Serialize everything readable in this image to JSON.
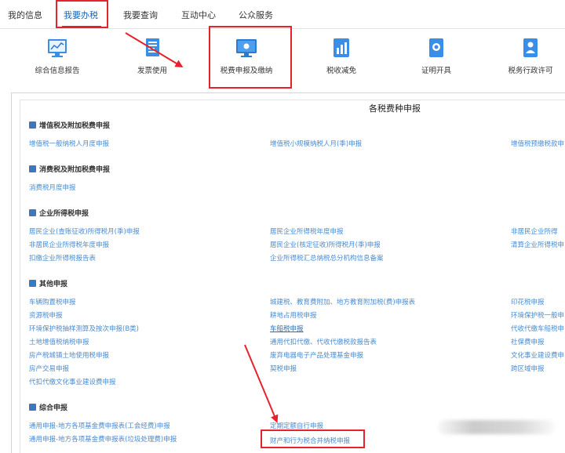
{
  "topnav": {
    "tabs": [
      "我的信息",
      "我要办税",
      "我要查询",
      "互动中心",
      "公众服务"
    ],
    "active_index": 1
  },
  "functions": [
    {
      "label": "综合信息报告",
      "icon": "report-chart-icon"
    },
    {
      "label": "发票使用",
      "icon": "invoice-icon"
    },
    {
      "label": "税费申报及缴纳",
      "icon": "monitor-icon"
    },
    {
      "label": "税收减免",
      "icon": "tax-relief-icon"
    },
    {
      "label": "证明开具",
      "icon": "certificate-icon"
    },
    {
      "label": "税务行政许可",
      "icon": "admin-permit-icon"
    }
  ],
  "panel": {
    "title": "各税费种申报",
    "sections": [
      {
        "title": "增值税及附加税费申报",
        "links": [
          "增值税一般纳税人月度申报",
          "增值税小规模纳税人月(季)申报",
          "增值税预缴税款申"
        ]
      },
      {
        "title": "消费税及附加税费申报",
        "links": [
          "消费税月度申报"
        ]
      },
      {
        "title": "企业所得税申报",
        "links": [
          "居民企业(查账征收)所得税月(季)申报",
          "居民企业所得税年度申报",
          "非居民企业所得",
          "非居民企业所得税年度申报",
          "居民企业(核定征收)所得税月(季)申报",
          "清算企业所得税申",
          "扣缴企业所得税报告表",
          "企业所得税汇总纳税总分机构信息备案"
        ]
      },
      {
        "title": "其他申报",
        "links": [
          "车辆购置税申报",
          "城建税、教育费附加、地方教育附加税(费)申报表",
          "印花税申报",
          "资源税申报",
          "耕地占用税申报",
          "环境保护税一般申",
          "环境保护税抽样测算及按次申报(B类)",
          "车船税申报",
          "代收代缴车船税申",
          "土地增值税纳税申报",
          "通用代扣代缴、代收代缴税款报告表",
          "社保费申报",
          "房产税城镇土地使用税申报",
          "废弃电器电子产品处理基金申报",
          "文化事业建设费申",
          "房产交易申报",
          "契税申报",
          "跨区域申报",
          "代扣代缴文化事业建设费申报"
        ]
      },
      {
        "title": "综合申报",
        "links": [
          "通用申报-地方各项基金费申报表(工会经费)申报",
          "定期定额自行申报",
          "通用申报-地方各项基金费申报表(垃圾处理费)申报",
          "财产和行为税合并纳税申报"
        ]
      }
    ]
  },
  "colors": {
    "accent": "#1a66b3",
    "link": "#4a8bd0",
    "annotation": "#e4232c"
  }
}
